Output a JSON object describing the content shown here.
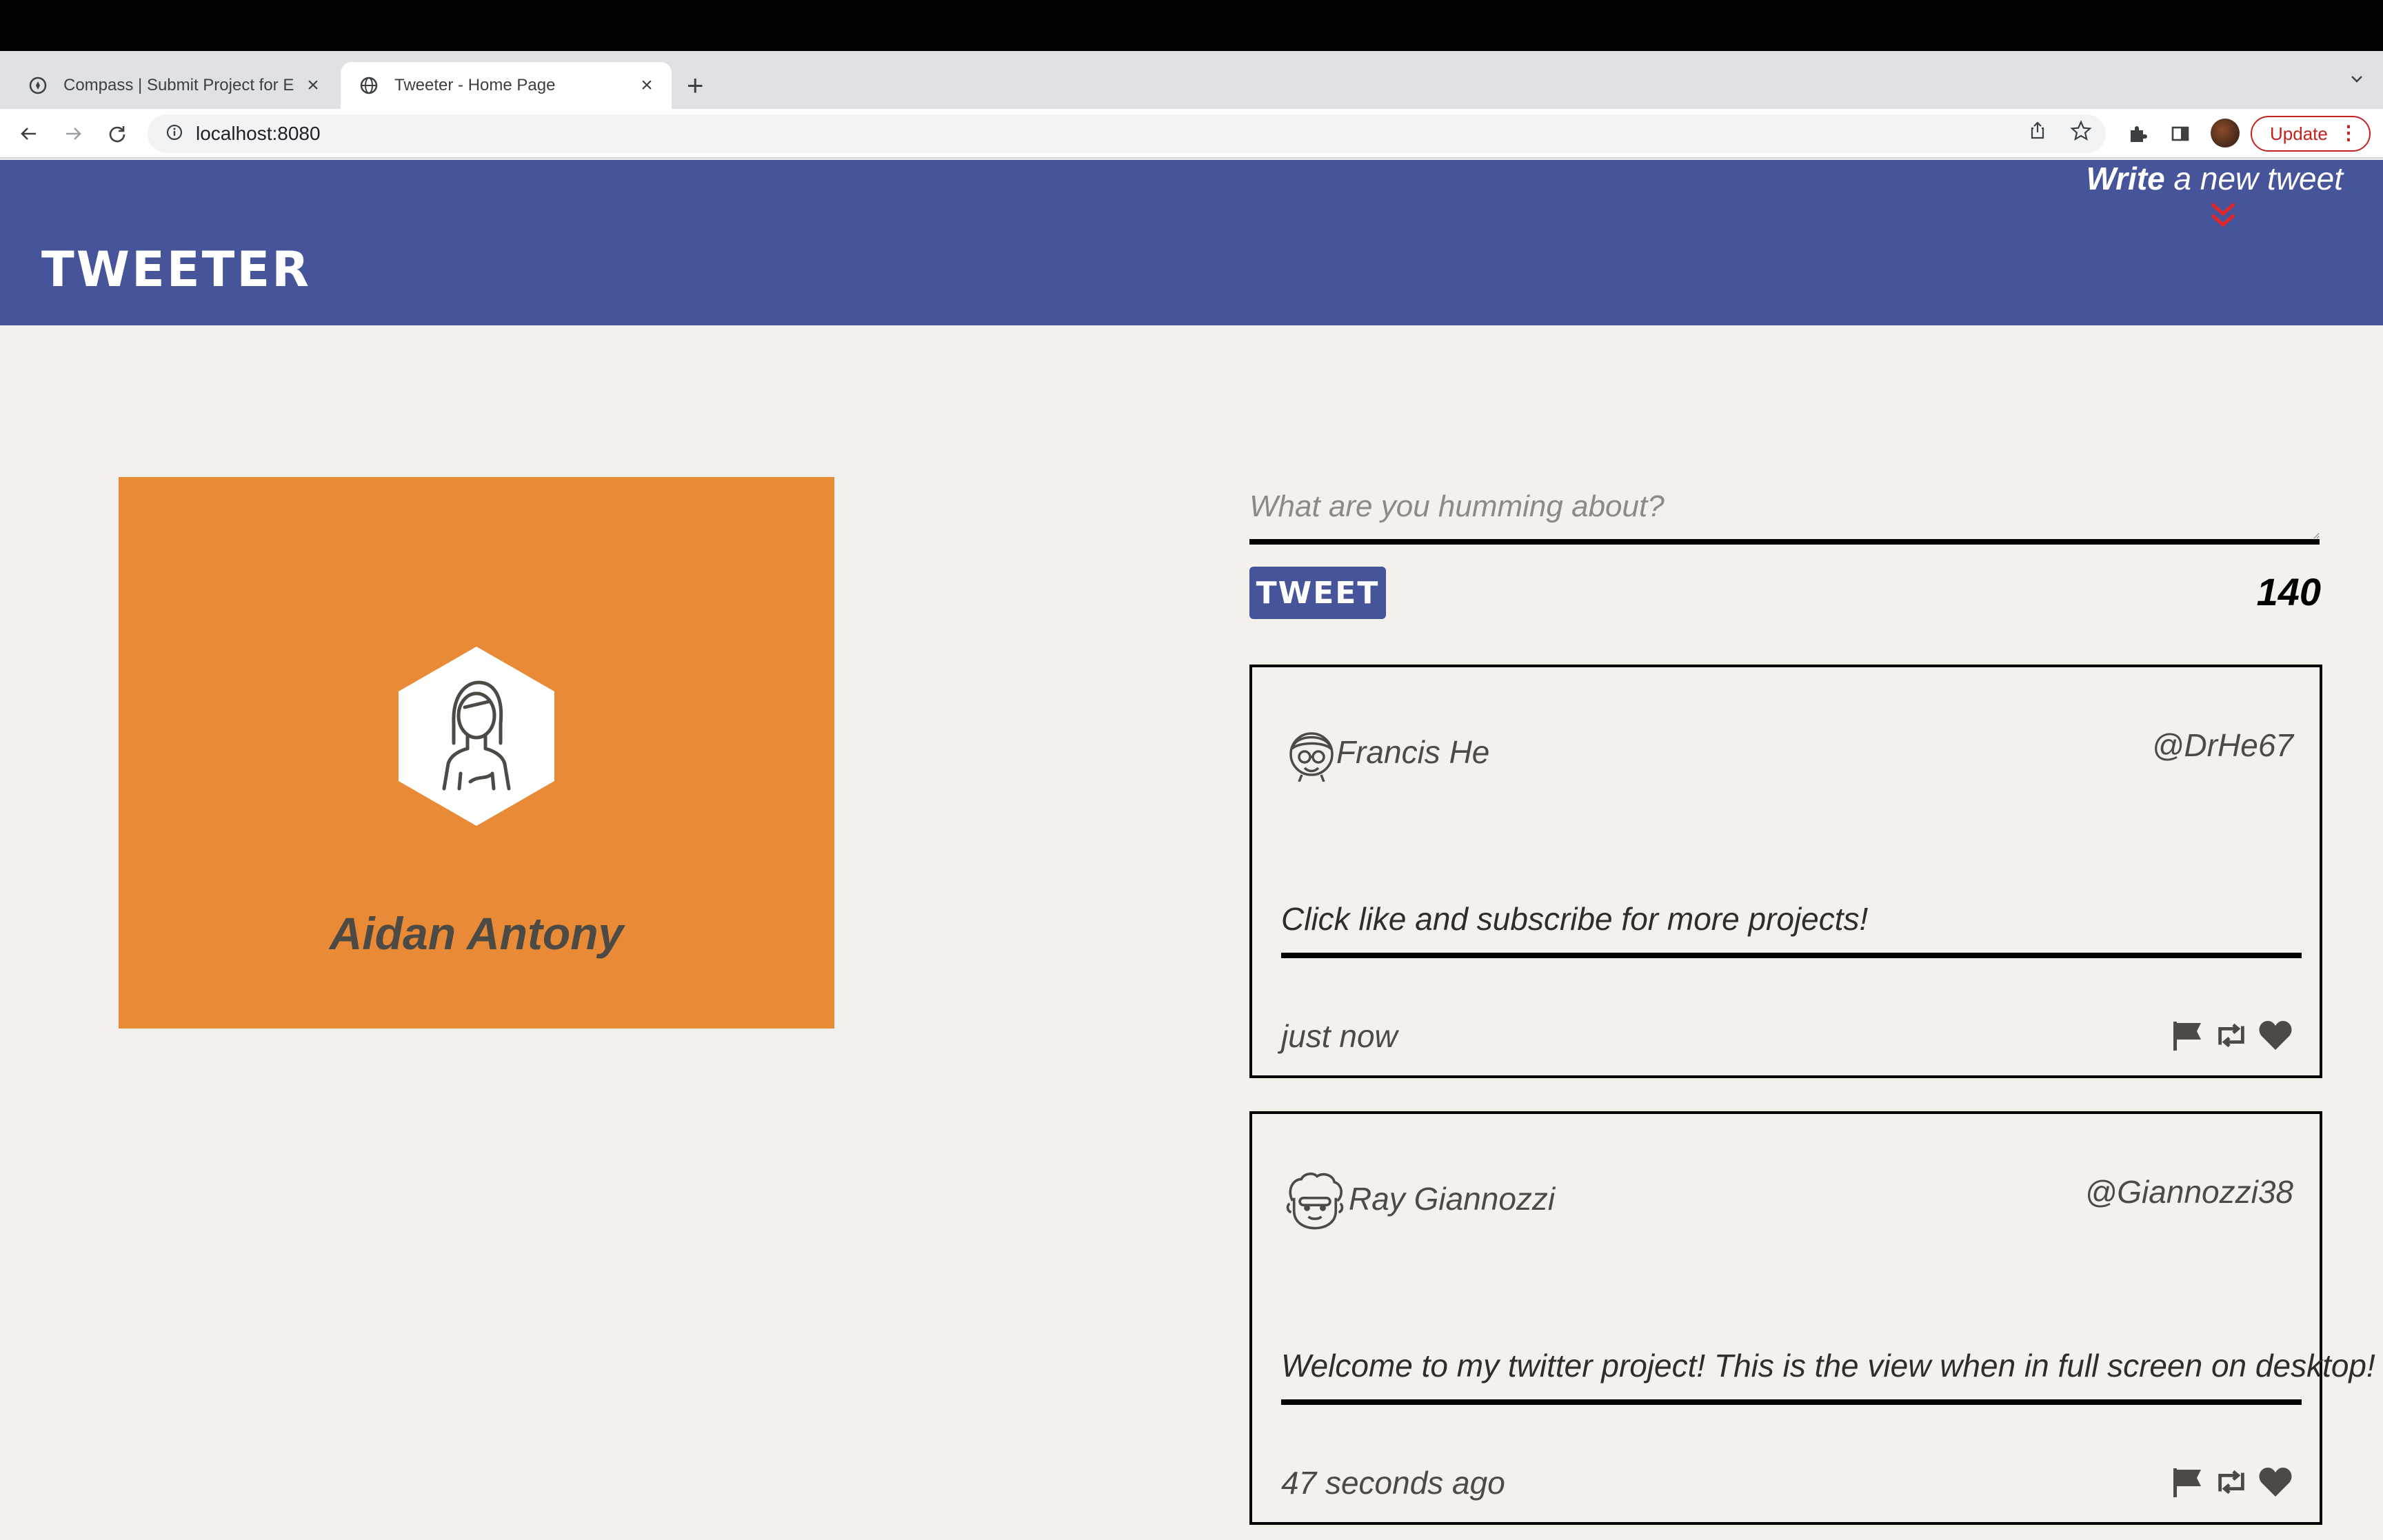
{
  "browser": {
    "tabs": [
      {
        "title": "Compass | Submit Project for E",
        "active": false
      },
      {
        "title": "Tweeter - Home Page",
        "active": true
      }
    ],
    "url": "localhost:8080",
    "update_label": "Update",
    "new_tab_symbol": "+",
    "close_symbol": "×"
  },
  "header": {
    "brand": "TWEETER",
    "write_bold": "Write",
    "write_rest": "a new tweet",
    "accent_color": "#e0262a"
  },
  "profile": {
    "name": "Aidan Antony",
    "background_color": "#e98a36"
  },
  "composer": {
    "placeholder": "What are you humming about?",
    "button_label": "TWEET",
    "counter": "140"
  },
  "tweets": [
    {
      "avatar": "glasses-man-avatar",
      "name": "Francis He",
      "handle": "@DrHe67",
      "text": "Click like and subscribe for more projects!",
      "time": "just now"
    },
    {
      "avatar": "curly-hair-man-avatar",
      "name": "Ray Giannozzi",
      "handle": "@Giannozzi38",
      "text": "Welcome to my twitter project! This is the view when in full screen on desktop!",
      "time": "47 seconds ago"
    }
  ],
  "colors": {
    "header_blue": "#465599",
    "page_bg": "#f4f1ec"
  }
}
